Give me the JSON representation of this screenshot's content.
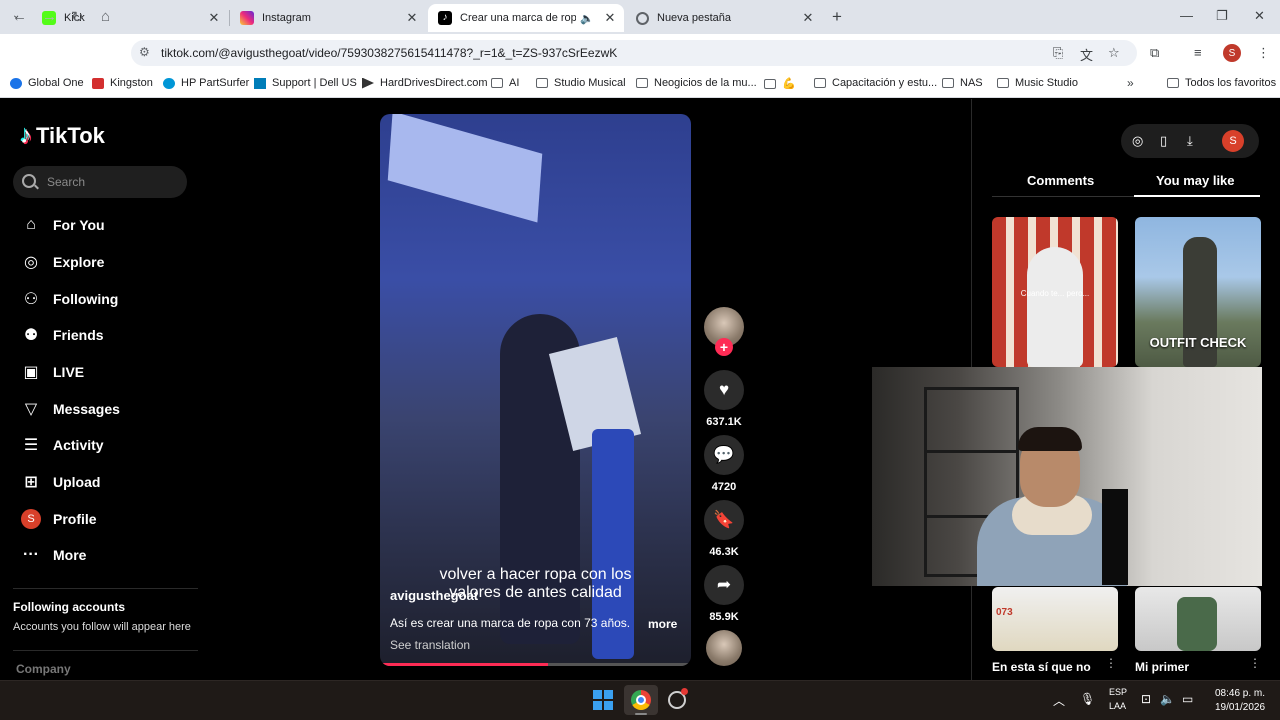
{
  "browser": {
    "tabs": [
      {
        "title": "Kick",
        "favicon_color": "#53fc18"
      },
      {
        "title": "Instagram",
        "favicon_color": "#d6249f"
      },
      {
        "title": "Crear una marca de ropa a",
        "favicon_color": "#000000"
      },
      {
        "title": "Nueva pestaña",
        "favicon_color": "#5f6368"
      }
    ],
    "url": "tiktok.com/@avigusthegoat/video/7593038275615411478?_r=1&_t=ZS-937cSrEezwK",
    "profile_initial": "S",
    "bookmarks": [
      "Global One",
      "Kingston",
      "HP PartSurfer",
      "Support | Dell US",
      "HardDrivesDirect.com",
      "AI",
      "Studio Musical",
      "Neogicios de la mu...",
      "💪",
      "Capacitación y estu...",
      "NAS",
      "Music Studio"
    ],
    "all_bookmarks": "Todos los favoritos"
  },
  "tiktok": {
    "logo": "TikTok",
    "search_placeholder": "Search",
    "nav": [
      {
        "label": "For You",
        "icon": "home-icon"
      },
      {
        "label": "Explore",
        "icon": "compass-icon"
      },
      {
        "label": "Following",
        "icon": "following-icon"
      },
      {
        "label": "Friends",
        "icon": "friends-icon"
      },
      {
        "label": "LIVE",
        "icon": "live-icon"
      },
      {
        "label": "Messages",
        "icon": "messages-icon"
      },
      {
        "label": "Activity",
        "icon": "activity-icon"
      },
      {
        "label": "Upload",
        "icon": "upload-icon"
      },
      {
        "label": "Profile",
        "icon": "avatar"
      },
      {
        "label": "More",
        "icon": "more-icon"
      }
    ],
    "profile_initial": "S",
    "following_title": "Following accounts",
    "following_sub": "Accounts you follow will appear here",
    "company": "Company",
    "video": {
      "caption_line1": "volver a hacer ropa con los",
      "caption_line2": "valores de antes calidad",
      "username": "avigusthegoat",
      "description": "Así es crear una marca de ropa con 73 años.",
      "more": "more",
      "see_translation": "See translation",
      "progress": 0.54
    },
    "actions": {
      "likes": "637.1K",
      "comments": "4720",
      "saves": "46.3K",
      "shares": "85.9K"
    },
    "right_panel": {
      "tab_comments": "Comments",
      "tab_you_may_like": "You may like",
      "thumb1_text": "Cuando te... pero...",
      "thumb2_text": "OUTFIT CHECK",
      "thumb3_text": "073",
      "caption1": "En esta sí que no",
      "caption2": "Mi primer",
      "profile_initial": "S"
    }
  },
  "taskbar": {
    "lang_line1": "ESP",
    "lang_line2": "LAA",
    "time": "08:46 p. m.",
    "date": "19/01/2026"
  },
  "colors": {
    "accent": "#fe2c55",
    "background": "#000000"
  }
}
